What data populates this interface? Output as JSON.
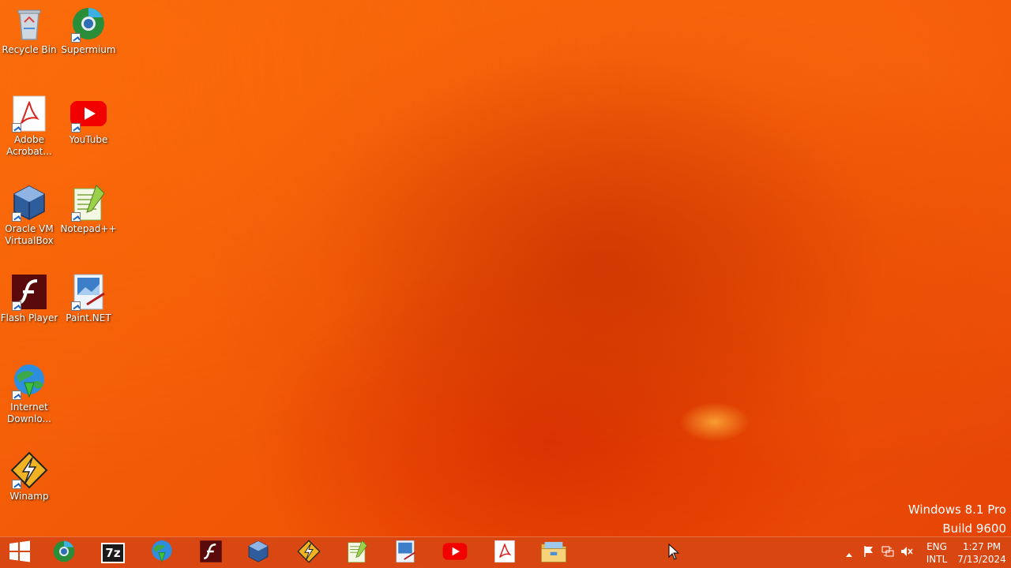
{
  "desktop": {
    "icons": [
      {
        "label": "Recycle Bin",
        "icon": "recycle-bin-icon"
      },
      {
        "label": "Supermium",
        "icon": "supermium-icon"
      },
      {
        "label": "Adobe Acrobat...",
        "icon": "adobe-acrobat-icon"
      },
      {
        "label": "YouTube",
        "icon": "youtube-icon"
      },
      {
        "label": "Oracle VM VirtualBox",
        "icon": "virtualbox-icon"
      },
      {
        "label": "Notepad++",
        "icon": "notepadpp-icon"
      },
      {
        "label": "Flash Player",
        "icon": "flash-player-icon"
      },
      {
        "label": "Paint.NET",
        "icon": "paintnet-icon"
      },
      {
        "label": "Internet Downlo...",
        "icon": "internet-download-manager-icon"
      },
      {
        "label": "Winamp",
        "icon": "winamp-icon"
      }
    ]
  },
  "watermark": {
    "line1": "Windows 8.1 Pro",
    "line2": "Build 9600"
  },
  "taskbar": {
    "start_icon": "windows-start-icon",
    "pinned": [
      "supermium-icon",
      "7zip-icon",
      "internet-download-manager-icon",
      "flash-player-icon",
      "virtualbox-icon",
      "winamp-icon",
      "notepadpp-icon",
      "paintnet-icon",
      "youtube-icon",
      "adobe-acrobat-icon",
      "file-explorer-icon"
    ],
    "pinned_7zip_text": "7z",
    "tray": {
      "language_line1": "ENG",
      "language_line2": "INTL",
      "time": "1:27 PM",
      "date": "7/13/2024"
    }
  },
  "colors": {
    "wallpaper": "#f25a06",
    "taskbar": "#d74614"
  }
}
